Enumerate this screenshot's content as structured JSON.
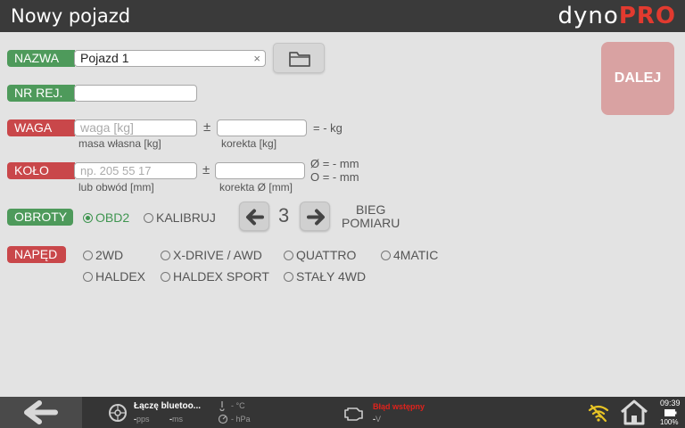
{
  "header": {
    "title": "Nowy pojazd",
    "logo_part1": "dyno",
    "logo_part2": "PRO"
  },
  "nazwa": {
    "label": "NAZWA",
    "value": "Pojazd 1",
    "clear": "×"
  },
  "nr_rej": {
    "label": "NR REJ.",
    "value": ""
  },
  "waga": {
    "label": "WAGA",
    "placeholder": "waga [kg]",
    "sub1": "masa własna [kg]",
    "pm": "±",
    "sub2": "korekta [kg]",
    "result": "= - kg"
  },
  "kolo": {
    "label": "KOŁO",
    "placeholder": "np. 205 55 17",
    "sub1": "lub obwód [mm]",
    "pm": "±",
    "sub2": "korekta Ø [mm]",
    "result1": "Ø = - mm",
    "result2": "O = - mm"
  },
  "obroty": {
    "label": "OBROTY",
    "opt1": "OBD2",
    "opt2": "KALIBRUJ",
    "gear": "3",
    "bieg1": "BIEG",
    "bieg2": "POMIARU"
  },
  "naped": {
    "label": "NAPĘD",
    "options": [
      "2WD",
      "X-DRIVE / AWD",
      "QUATTRO",
      "4MATIC",
      "HALDEX",
      "HALDEX SPORT",
      "STAŁY 4WD"
    ]
  },
  "dalej": "DALEJ",
  "status": {
    "bluetooth": "Łączę bluetoo...",
    "pps": "-",
    "pps_unit": "pps",
    "ms": "-",
    "ms_unit": "ms",
    "temp": "- °C",
    "press": "- hPa",
    "warning": "Błąd wstępny",
    "volt": "-",
    "volt_unit": "V",
    "time": "09:39",
    "battery": "100%"
  },
  "colors": {
    "green": "#4e9a5b",
    "red": "#c9474a",
    "dalej": "#d9a2a2"
  }
}
